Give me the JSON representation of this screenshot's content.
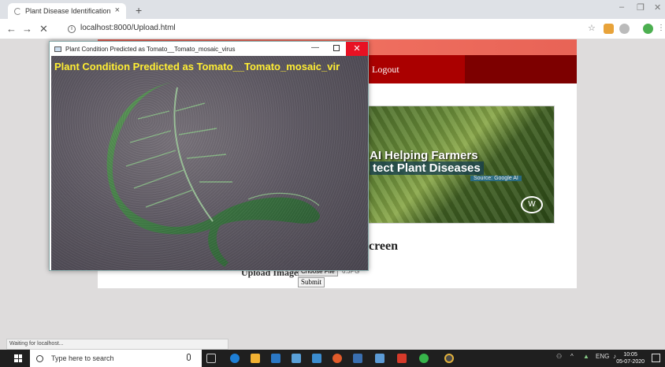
{
  "browser": {
    "tab_title": "Plant Disease Identification",
    "tab_close": "×",
    "new_tab": "+",
    "url": "localhost:8000/Upload.html",
    "back": "←",
    "forward": "→",
    "stop": "✕",
    "minimize": "–",
    "restore": "❐",
    "close": "✕"
  },
  "page": {
    "nav_logout": "Logout",
    "banner_line1": "AI Helping Farmers",
    "banner_line2": "tect Plant Diseases",
    "banner_source": "Source: Google AI",
    "banner_logo": "W",
    "section_title": "creen",
    "upload_label": "Upload Image",
    "choose_file": "Choose File",
    "file_name": "6.JPG",
    "submit": "Submit"
  },
  "cv_window": {
    "title": "Plant Condition Predicted as Tomato__Tomato_mosaic_virus",
    "minimize": "—",
    "close": "✕",
    "caption": "Plant Condition Predicted as Tomato__Tomato_mosaic_vir"
  },
  "status": {
    "text": "Waiting for localhost..."
  },
  "taskbar": {
    "search_placeholder": "Type here to search",
    "time": "10:05",
    "date": "05-07-2020",
    "lang": "ENG"
  },
  "colors": {
    "nav_red": "#aa0000",
    "caption_yellow": "#ffee33",
    "close_red": "#e81123"
  }
}
